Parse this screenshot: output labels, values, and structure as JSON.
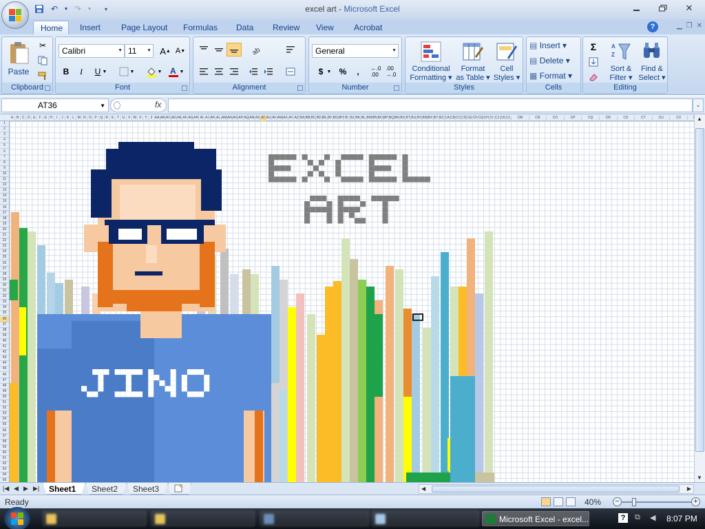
{
  "window": {
    "title_doc": "excel art",
    "title_sep": " - ",
    "title_app": "Microsoft Excel"
  },
  "tabs": [
    "Home",
    "Insert",
    "Page Layout",
    "Formulas",
    "Data",
    "Review",
    "View",
    "Acrobat"
  ],
  "active_tab": "Home",
  "ribbon": {
    "clipboard": {
      "label": "Clipboard",
      "paste": "Paste"
    },
    "font": {
      "label": "Font",
      "name": "Calibri",
      "size": "11",
      "bold": "B",
      "italic": "I",
      "underline": "U"
    },
    "alignment": {
      "label": "Alignment"
    },
    "number": {
      "label": "Number",
      "format": "General",
      "currency": "$",
      "percent": "%",
      "comma": ","
    },
    "styles": {
      "label": "Styles",
      "conditional": "Conditional",
      "formatting": "Formatting",
      "format_as": "Format",
      "as_table": "as Table",
      "cell": "Cell",
      "cell_styles": "Styles"
    },
    "cells": {
      "label": "Cells",
      "insert": "Insert",
      "delete": "Delete",
      "format": "Format"
    },
    "editing": {
      "label": "Editing",
      "sort": "Sort &",
      "filter": "Filter",
      "find": "Find &",
      "select": "Select",
      "sum": "Σ"
    }
  },
  "formula_bar": {
    "name_box": "AT36",
    "fx": "fx",
    "value": ""
  },
  "sheets": [
    "Sheet1",
    "Sheet2",
    "Sheet3"
  ],
  "active_sheet": "Sheet1",
  "status": {
    "ready": "Ready",
    "zoom": "40%"
  },
  "taskbar": {
    "active_window": "Microsoft Excel - excel...",
    "clock": "8:07 PM"
  },
  "art": {
    "heading_line1": "EXCEL",
    "heading_line2": "ART",
    "shirt_text": "JINO",
    "colors": {
      "hair": "#0b2566",
      "skin": "#f6c9a0",
      "skin_light": "#fbdcc0",
      "beard": "#e5731c",
      "glasses": "#0b2566",
      "shirt": "#5b8dd9",
      "shirt_dark": "#4a7cc8",
      "heading": "#7f7f7f"
    }
  }
}
